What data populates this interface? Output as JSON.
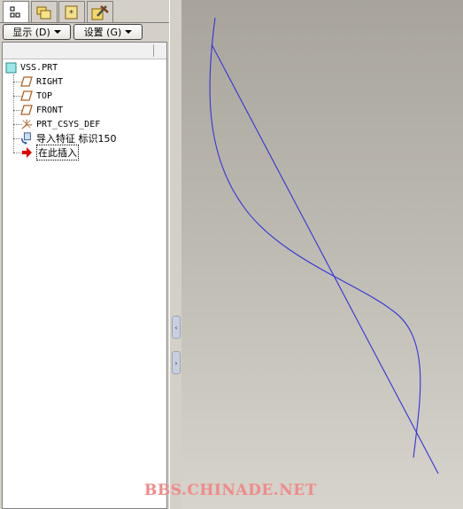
{
  "tabs": [
    {
      "name": "model-tree-tab",
      "icon": "tree-icon",
      "active": true
    },
    {
      "name": "folder-browser-tab",
      "icon": "folder-icon",
      "active": false
    },
    {
      "name": "favorites-tab",
      "icon": "favorites-icon",
      "active": false
    },
    {
      "name": "connections-tab",
      "icon": "tools-icon",
      "active": false
    }
  ],
  "toolbar": {
    "display_label": "显示 (D)",
    "settings_label": "设置 (G)"
  },
  "tree": {
    "root": "VSS.PRT",
    "items": [
      {
        "label": "RIGHT",
        "icon": "datum-plane-icon"
      },
      {
        "label": "TOP",
        "icon": "datum-plane-icon"
      },
      {
        "label": "FRONT",
        "icon": "datum-plane-icon"
      },
      {
        "label": "PRT_CSYS_DEF",
        "icon": "coordinate-system-icon"
      },
      {
        "label": "导入特征 标识150",
        "icon": "import-feature-icon"
      },
      {
        "label": "在此插入",
        "icon": "insert-here-arrow-icon"
      }
    ]
  },
  "watermark": "BBS.CHINADE.NET",
  "colors": {
    "curve": "#3333dd",
    "datum_plane": "#b06020",
    "insert_arrow": "#dd0000",
    "watermark": "#f08a8a"
  }
}
